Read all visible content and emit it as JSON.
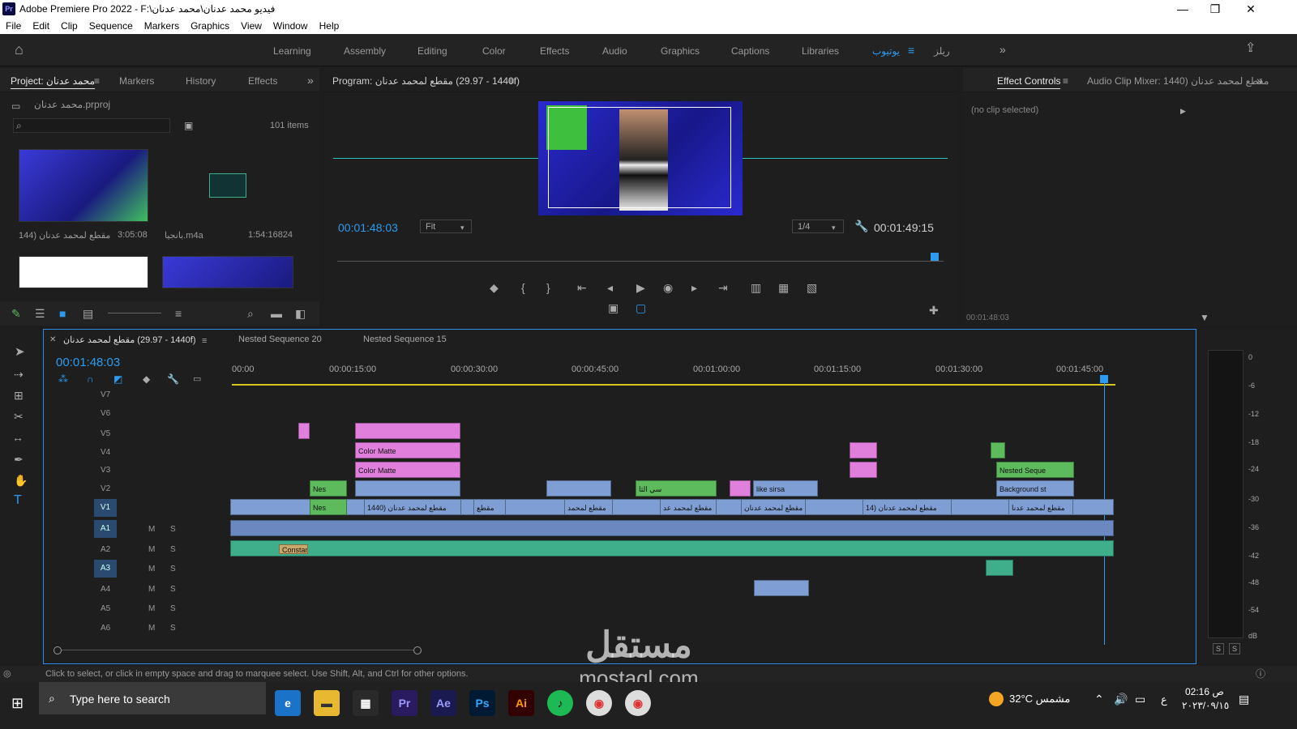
{
  "window": {
    "title": "Adobe Premiere Pro 2022 - F:\\فيديو محمد عدنان\\محمد عدنان",
    "app_icon": "Pr",
    "controls": [
      "—",
      "❐",
      "✕"
    ]
  },
  "menu": [
    "File",
    "Edit",
    "Clip",
    "Sequence",
    "Markers",
    "Graphics",
    "View",
    "Window",
    "Help"
  ],
  "workspaces": [
    "Learning",
    "Assembly",
    "Editing",
    "Color",
    "Effects",
    "Audio",
    "Graphics",
    "Captions",
    "Libraries",
    "يوتيوب",
    "ريلز"
  ],
  "project": {
    "tabs": [
      "Project: محمد عدنان",
      "Markers",
      "History",
      "Effects"
    ],
    "file": "محمد عدنان.prproj",
    "items_count": "101 items",
    "items": [
      {
        "name": "مقطع لمحمد عدنان (144",
        "duration": "3:05:08"
      },
      {
        "name": "بانجيا.m4a",
        "duration": "1:54:16824"
      }
    ]
  },
  "program": {
    "title": "Program: مقطع لمحمد عدنان (1440 - 29.97f)",
    "timecode": "00:01:48:03",
    "fit": "Fit",
    "resolution": "1/4",
    "duration": "00:01:49:15"
  },
  "effects": {
    "tabs": [
      "Effect Controls",
      "Audio Clip Mixer: مقطع لمحمد عدنان (1440"
    ],
    "no_clip": "(no clip selected)",
    "timecode": "00:01:48:03"
  },
  "timeline": {
    "tabs": [
      "مقطع لمحمد عدنان (1440 - 29.97f)",
      "Nested Sequence 20",
      "Nested Sequence 15"
    ],
    "timecode": "00:01:48:03",
    "ruler": [
      "00:00",
      "00:00:15:00",
      "00:00:30:00",
      "00:00:45:00",
      "00:01:00:00",
      "00:01:15:00",
      "00:01:30:00",
      "00:01:45:00"
    ],
    "video_tracks": [
      "V7",
      "V6",
      "V5",
      "V4",
      "V3",
      "V2",
      "V1"
    ],
    "audio_tracks": [
      "A1",
      "A2",
      "A3",
      "A4",
      "A5",
      "A6"
    ],
    "mute": "M",
    "solo": "S",
    "clip_labels": {
      "color_matte": "Color Matte",
      "nested_seq": "Nested Seque",
      "background": "Background st",
      "like_sirsa": "like sirsa",
      "nes": "Nes",
      "constant": "Constant",
      "clip_a": "مقطع لمحمد عدنان (1440",
      "clip_b": "مقطع",
      "clip_c": "مقطع لمحمد",
      "clip_d": "مقطع لمحمد عد",
      "clip_e": "مقطع لمحمد عدنان",
      "clip_f": "مقطع لمحمد عدنان (14",
      "clip_g": "مقطع لمحمد عدنا",
      "clip_h": "سي الثا"
    }
  },
  "meter": {
    "scale": [
      "0",
      "-6",
      "-12",
      "-18",
      "-24",
      "-30",
      "-36",
      "-42",
      "-48",
      "-54",
      "dB"
    ],
    "solo_buttons": [
      "S",
      "S"
    ]
  },
  "status": "Click to select, or click in empty space and drag to marquee select. Use Shift, Alt, and Ctrl for other options.",
  "taskbar": {
    "search": "Type here to search",
    "weather": "32°C مشمس",
    "time": "02:16 ص",
    "date": "٢٠٢٣/٠٩/١٥",
    "lang": "ع",
    "apps": [
      "Pr",
      "Ae",
      "Ps",
      "Ai"
    ]
  },
  "watermark": {
    "arabic": "مستقل",
    "latin": "mostaql.com"
  }
}
